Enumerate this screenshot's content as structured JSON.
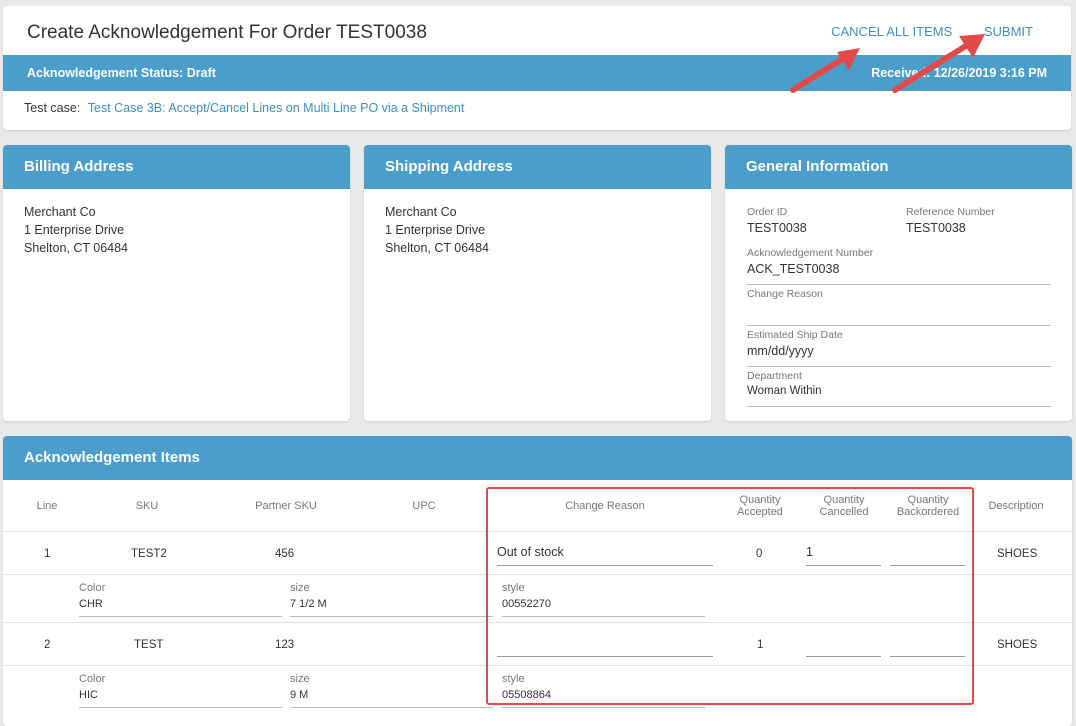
{
  "header": {
    "title": "Create Acknowledgement For Order TEST0038",
    "cancel_all_label": "CANCEL ALL ITEMS",
    "submit_label": "SUBMIT",
    "status": "Acknowledgement Status: Draft",
    "received": "Received: 12/26/2019 3:16 PM",
    "testcase_label": "Test case:",
    "testcase_link": "Test Case 3B: Accept/Cancel Lines on Multi Line PO via a Shipment"
  },
  "billing": {
    "title": "Billing Address",
    "lines": [
      "Merchant Co",
      "1 Enterprise Drive",
      "Shelton, CT 06484"
    ]
  },
  "shipping": {
    "title": "Shipping Address",
    "lines": [
      "Merchant Co",
      "1 Enterprise Drive",
      "Shelton, CT 06484"
    ]
  },
  "general": {
    "title": "General Information",
    "order_id_label": "Order ID",
    "order_id": "TEST0038",
    "ref_label": "Reference Number",
    "ref": "TEST0038",
    "ack_label": "Acknowledgement Number",
    "ack": "ACK_TEST0038",
    "change_reason_label": "Change Reason",
    "change_reason": "",
    "ship_date_label": "Estimated Ship Date",
    "ship_date_placeholder": "mm/dd/yyyy",
    "dept_label": "Department",
    "dept": "Woman Within"
  },
  "items": {
    "title": "Acknowledgement Items",
    "columns": {
      "line": "Line",
      "sku": "SKU",
      "partner_sku": "Partner SKU",
      "upc": "UPC",
      "change_reason": "Change Reason",
      "qty_accepted_1": "Quantity",
      "qty_accepted_2": "Accepted",
      "qty_cancelled_1": "Quantity",
      "qty_cancelled_2": "Cancelled",
      "qty_backordered_1": "Quantity",
      "qty_backordered_2": "Backordered",
      "description": "Description"
    },
    "rows": [
      {
        "line": "1",
        "sku": "TEST2",
        "partner_sku": "456",
        "upc": "",
        "change_reason": "Out of stock",
        "accepted": "0",
        "cancelled": "1",
        "backordered": "",
        "description": "SHOES",
        "color_label": "Color",
        "color": "CHR",
        "size_label": "size",
        "size": "7 1/2 M",
        "style_label": "style",
        "style": "00552270"
      },
      {
        "line": "2",
        "sku": "TEST",
        "partner_sku": "123",
        "upc": "",
        "change_reason": "",
        "accepted": "1",
        "cancelled": "",
        "backordered": "",
        "description": "SHOES",
        "color_label": "Color",
        "color": "HIC",
        "size_label": "size",
        "size": "9 M",
        "style_label": "style",
        "style": "05508864"
      }
    ]
  },
  "colors": {
    "accent": "#4a9ec9",
    "link": "#3f8fc4",
    "annotation": "#e24a4a"
  }
}
